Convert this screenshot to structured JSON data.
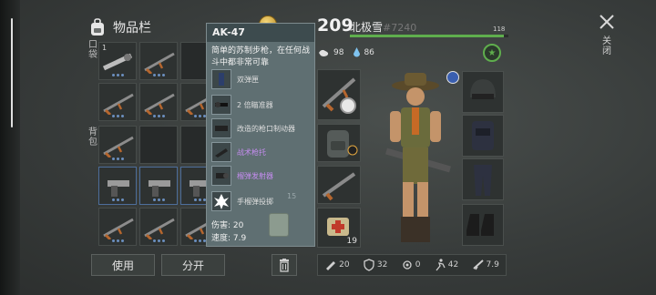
{
  "inventory": {
    "title": "物品栏",
    "section_backpack": "口袋",
    "section_bag": "背包",
    "slot_count_first": "1"
  },
  "tooltip": {
    "title": "AK-47",
    "description": "简单的苏制步枪，在任何战斗中都非常可靠",
    "mods": [
      {
        "label": "双弹匣",
        "icon": "magazine-icon",
        "style": "normal"
      },
      {
        "label": "2 倍瞄准器",
        "icon": "scope-icon",
        "style": "normal"
      },
      {
        "label": "改造的枪口制动器",
        "icon": "muzzle-icon",
        "style": "normal"
      },
      {
        "label": "战术枪托",
        "icon": "stock-icon",
        "style": "purple"
      },
      {
        "label": "榴弹发射器",
        "icon": "launcher-icon",
        "style": "purple"
      },
      {
        "label": "手榴弹投掷",
        "icon": "grenade-icon",
        "style": "normal"
      }
    ],
    "damage": "伤害: 20",
    "speed": "速度: 7.9",
    "bg_count": "15"
  },
  "buttons": {
    "use": "使用",
    "split": "分开"
  },
  "player": {
    "level": "209",
    "name": "北极雪",
    "id": "#7240",
    "xp_value": "118",
    "xp_fraction": 0.97,
    "hunger": "98",
    "thirst": "86"
  },
  "equipment": {
    "ammo_count": "19"
  },
  "bottom_stats": [
    {
      "icon": "attack-icon",
      "value": "20"
    },
    {
      "icon": "armor-icon",
      "value": "32"
    },
    {
      "icon": "noise-icon",
      "value": "0"
    },
    {
      "icon": "speed-icon",
      "value": "42"
    },
    {
      "icon": "weapon-speed-icon",
      "value": "7.9"
    }
  ],
  "close": {
    "label": "关闭"
  },
  "colors": {
    "accent_green": "#5fae4d",
    "tooltip_bg": "#5f6f72",
    "purple_mod": "#c58cf0"
  }
}
